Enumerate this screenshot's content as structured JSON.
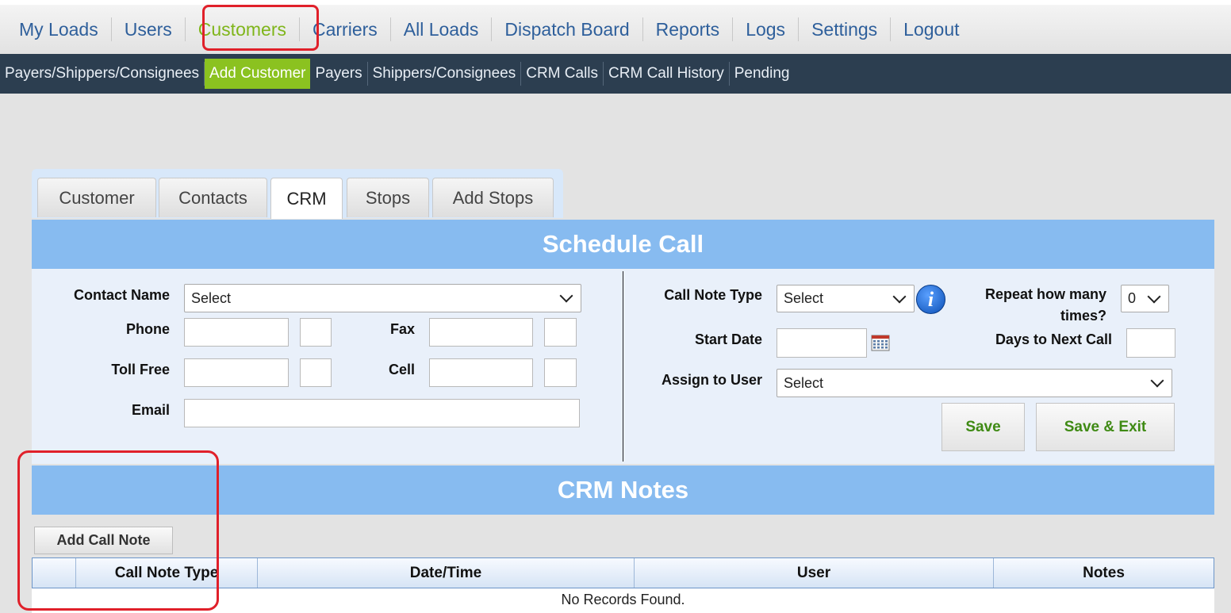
{
  "top_nav": {
    "items": [
      "My Loads",
      "Users",
      "Customers",
      "Carriers",
      "All Loads",
      "Dispatch Board",
      "Reports",
      "Logs",
      "Settings",
      "Logout"
    ],
    "active": "Customers"
  },
  "sub_nav": {
    "items": [
      "Payers/Shippers/Consignees",
      "Add Customer",
      "Payers",
      "Shippers/Consignees",
      "CRM Calls",
      "CRM Call History",
      "Pending"
    ],
    "active": "Add Customer"
  },
  "tabs": {
    "items": [
      "Customer",
      "Contacts",
      "CRM",
      "Stops",
      "Add Stops"
    ],
    "active": "CRM"
  },
  "schedule_call": {
    "title": "Schedule Call",
    "contact_name_label": "Contact Name",
    "contact_name_value": "Select",
    "phone_label": "Phone",
    "fax_label": "Fax",
    "toll_free_label": "Toll Free",
    "cell_label": "Cell",
    "email_label": "Email",
    "call_note_type_label": "Call Note Type",
    "call_note_type_value": "Select",
    "repeat_label": "Repeat how many times?",
    "repeat_value": "0",
    "start_date_label": "Start Date",
    "days_next_label": "Days to Next Call",
    "assign_label": "Assign to User",
    "assign_value": "Select",
    "save_label": "Save",
    "save_exit_label": "Save & Exit"
  },
  "crm_notes": {
    "title": "CRM Notes",
    "add_button": "Add Call Note",
    "columns": [
      "",
      "Call Note Type",
      "Date/Time",
      "User",
      "Notes"
    ],
    "empty_text": "No Records Found."
  },
  "colors": {
    "accent_green": "#8bc220",
    "header_blue": "#87bbf0",
    "subnav_dark": "#2c3e50",
    "highlight_red": "#e0202a"
  }
}
